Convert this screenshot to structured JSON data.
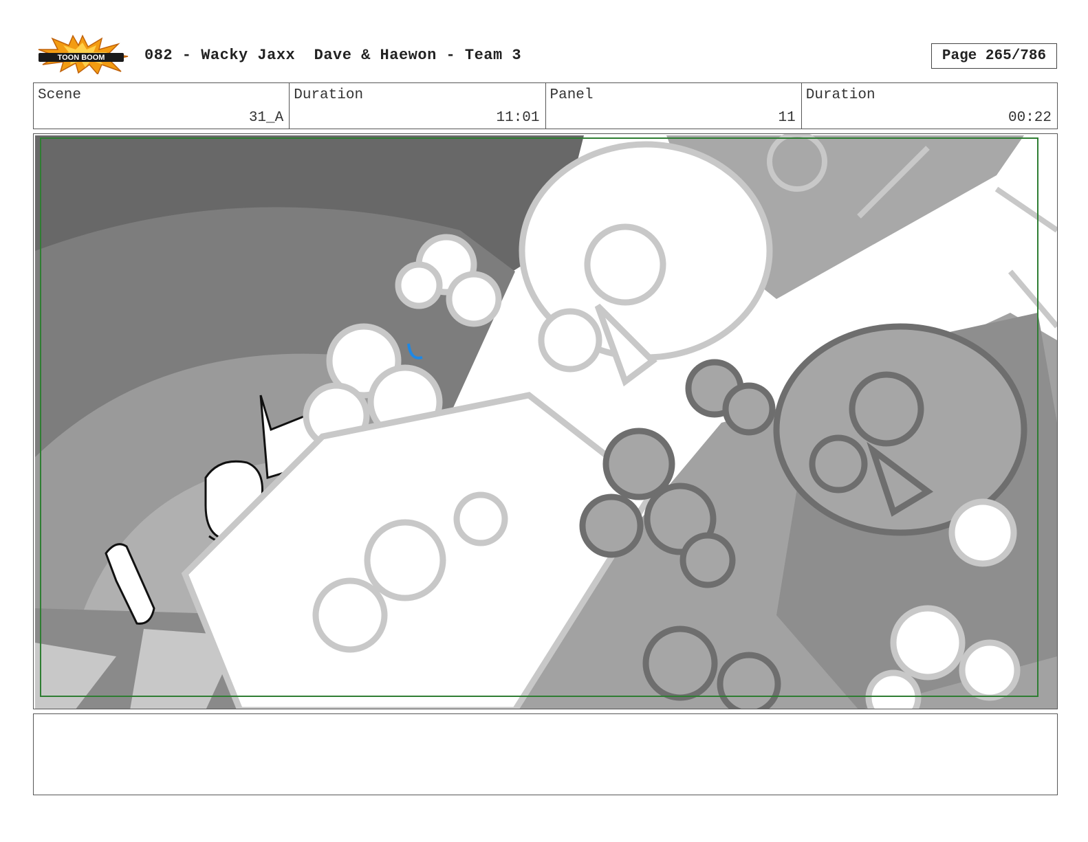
{
  "header": {
    "logo_text": "TOON BOOM",
    "title": "082 - Wacky Jaxx  Dave & Haewon - Team 3",
    "page_label": "Page 265/786"
  },
  "info": {
    "scene_label": "Scene",
    "scene_value": "31_A",
    "duration_label": "Duration",
    "duration_value": "11:01",
    "panel_label": "Panel",
    "panel_value": "11",
    "panel_duration_label": "Duration",
    "panel_duration_value": "00:22"
  },
  "colors": {
    "safe_frame": "#2e7d32",
    "accent_blue": "#1e88e5",
    "logo_orange": "#f39c12"
  },
  "notes": ""
}
